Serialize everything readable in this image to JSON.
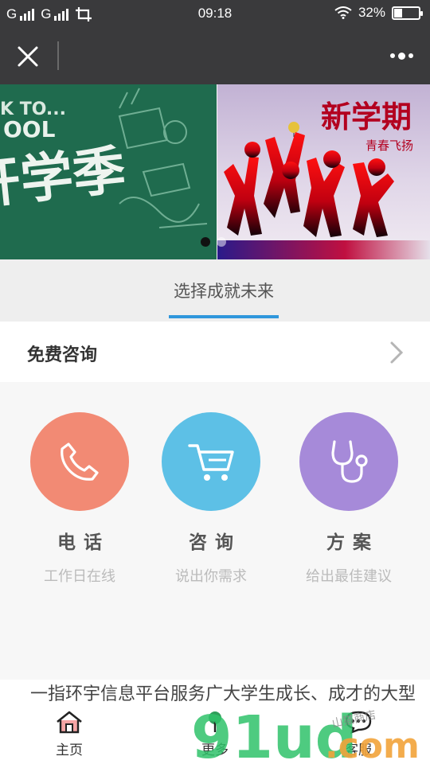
{
  "status_bar": {
    "carrier1": "G",
    "carrier2": "G",
    "time": "09:18",
    "battery": "32%",
    "battery_level": 0.32
  },
  "banner": {
    "slides": [
      {
        "text_top": "K TO...",
        "text_mid": "OOL",
        "text_main": "开学季"
      },
      {
        "text_main": "新学期",
        "text_sub": "青春飞扬"
      }
    ],
    "active_index": 0,
    "colors": {
      "slide1": "#1f6b4e",
      "slide2": "#c2b2d4"
    }
  },
  "tab": {
    "label": "选择成就未来",
    "accent": "#2f97dc"
  },
  "section": {
    "title": "免费咨询"
  },
  "features": [
    {
      "icon": "phone-icon",
      "title": "电话",
      "subtitle": "工作日在线",
      "color": "#f28a74"
    },
    {
      "icon": "cart-icon",
      "title": "咨询",
      "subtitle": "说出你需求",
      "color": "#5dc0e6"
    },
    {
      "icon": "stethoscope-icon",
      "title": "方案",
      "subtitle": "给出最佳建议",
      "color": "#a68ad9"
    }
  ],
  "marquee": {
    "text": "一指环宇信息平台服务广大学生成长、成才的大型"
  },
  "bottom_nav": [
    {
      "icon": "home-icon",
      "label": "主页"
    },
    {
      "icon": "tree-icon",
      "label": "更多"
    },
    {
      "icon": "chat-icon",
      "label": "客服"
    }
  ],
  "watermark": {
    "text_main": "91ud",
    "text_suffix": ".com",
    "text_small": "山猫商店"
  }
}
